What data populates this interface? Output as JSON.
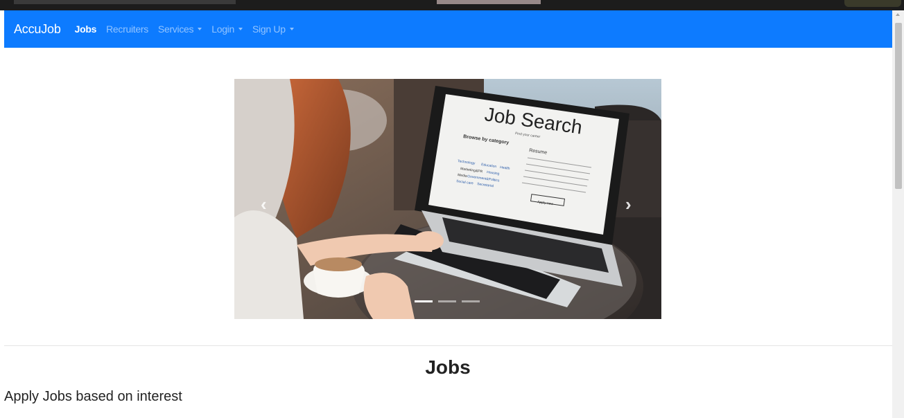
{
  "navbar": {
    "brand": "AccuJob",
    "items": [
      {
        "label": "Jobs",
        "active": true,
        "dropdown": false
      },
      {
        "label": "Recruiters",
        "active": false,
        "dropdown": false
      },
      {
        "label": "Services",
        "active": false,
        "dropdown": true
      },
      {
        "label": "Login",
        "active": false,
        "dropdown": true
      },
      {
        "label": "Sign Up",
        "active": false,
        "dropdown": true
      }
    ],
    "color": "#0d7bff"
  },
  "carousel": {
    "screen_title": "Job Search",
    "screen_tagline": "Find your career",
    "category_heading": "Browse by category",
    "resume_heading": "Resume",
    "resume_button": "Apply now",
    "categories": [
      "Technology",
      "Education",
      "Health",
      "Marketing&PR",
      "Housing",
      "Media",
      "Government&Politics",
      "Social care",
      "Secretarial"
    ],
    "prev_icon": "chevron-left-icon",
    "next_icon": "chevron-right-icon",
    "slide_count": 3,
    "active_slide": 1
  },
  "section": {
    "title": "Jobs",
    "subtitle": "Apply Jobs based on interest"
  }
}
